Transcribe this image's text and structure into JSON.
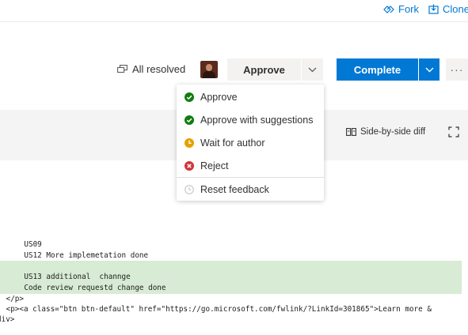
{
  "header": {
    "fork_label": "Fork",
    "clone_label": "Clone"
  },
  "toolbar": {
    "resolved_label": "All resolved",
    "approve_label": "Approve",
    "complete_label": "Complete",
    "more_label": "···"
  },
  "vote_menu": {
    "items": [
      {
        "label": "Approve",
        "status": "approved",
        "color": "#107c10"
      },
      {
        "label": "Approve with suggestions",
        "status": "approved",
        "color": "#107c10"
      },
      {
        "label": "Wait for author",
        "status": "waiting",
        "color": "#e6a000"
      },
      {
        "label": "Reject",
        "status": "rejected",
        "color": "#d13438"
      },
      {
        "label": "Reset feedback",
        "status": "reset",
        "color": "#c8c6c4"
      }
    ]
  },
  "diff_view": {
    "side_by_side_label": "Side-by-side diff"
  },
  "code": {
    "lines": [
      "    US09",
      "    US12 More implemetation done",
      "",
      "    US13 additional  channge",
      "    Code review requestd change done",
      " </p>",
      " <p><a class=\"btn btn-default\" href=\"https://go.microsoft.com/fwlink/?LinkId=301865\">Learn more &",
      "div>"
    ]
  },
  "colors": {
    "accent": "#0078d4",
    "added_line_bg": "#d8ebd4"
  }
}
